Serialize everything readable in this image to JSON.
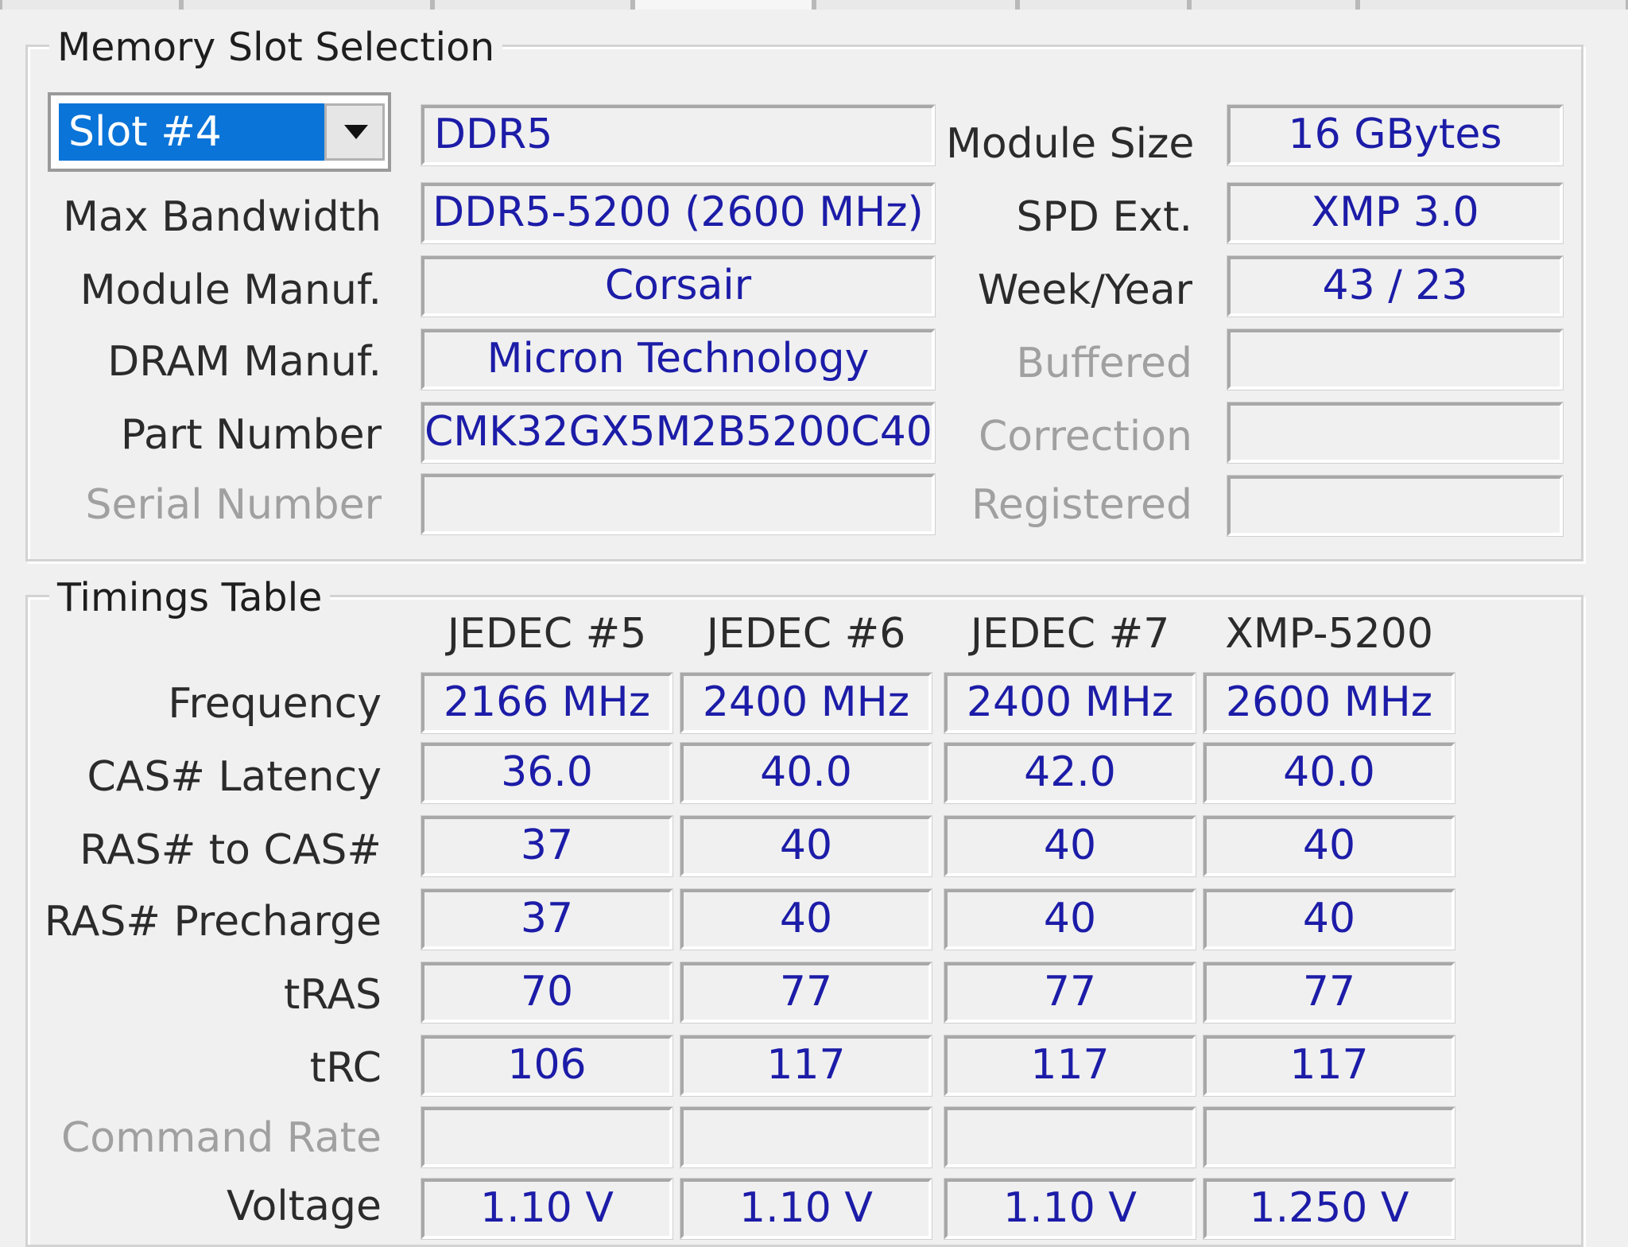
{
  "memory_slot": {
    "group_title": "Memory Slot Selection",
    "slot_selected": "Slot #4",
    "memory_type": "DDR5",
    "rows_left": [
      {
        "label": "Max Bandwidth",
        "value": "DDR5-5200 (2600 MHz)",
        "enabled": true
      },
      {
        "label": "Module Manuf.",
        "value": "Corsair",
        "enabled": true
      },
      {
        "label": "DRAM Manuf.",
        "value": "Micron Technology",
        "enabled": true
      },
      {
        "label": "Part Number",
        "value": "CMK32GX5M2B5200C40",
        "enabled": true
      },
      {
        "label": "Serial Number",
        "value": "",
        "enabled": false
      }
    ],
    "rows_right": [
      {
        "label": "Module Size",
        "value": "16 GBytes",
        "enabled": true
      },
      {
        "label": "SPD Ext.",
        "value": "XMP 3.0",
        "enabled": true
      },
      {
        "label": "Week/Year",
        "value": "43 / 23",
        "enabled": true
      },
      {
        "label": "Buffered",
        "value": "",
        "enabled": false
      },
      {
        "label": "Correction",
        "value": "",
        "enabled": false
      },
      {
        "label": "Registered",
        "value": "",
        "enabled": false
      }
    ]
  },
  "timings": {
    "group_title": "Timings Table",
    "columns": [
      "JEDEC #5",
      "JEDEC #6",
      "JEDEC #7",
      "XMP-5200"
    ],
    "rows": [
      {
        "label": "Frequency",
        "values": [
          "2166 MHz",
          "2400 MHz",
          "2400 MHz",
          "2600 MHz"
        ],
        "enabled": true
      },
      {
        "label": "CAS# Latency",
        "values": [
          "36.0",
          "40.0",
          "42.0",
          "40.0"
        ],
        "enabled": true
      },
      {
        "label": "RAS# to CAS#",
        "values": [
          "37",
          "40",
          "40",
          "40"
        ],
        "enabled": true
      },
      {
        "label": "RAS# Precharge",
        "values": [
          "37",
          "40",
          "40",
          "40"
        ],
        "enabled": true
      },
      {
        "label": "tRAS",
        "values": [
          "70",
          "77",
          "77",
          "77"
        ],
        "enabled": true
      },
      {
        "label": "tRC",
        "values": [
          "106",
          "117",
          "117",
          "117"
        ],
        "enabled": true
      },
      {
        "label": "Command Rate",
        "values": [
          "",
          "",
          "",
          ""
        ],
        "enabled": false
      },
      {
        "label": "Voltage",
        "values": [
          "1.10 V",
          "1.10 V",
          "1.10 V",
          "1.250 V"
        ],
        "enabled": true
      }
    ]
  },
  "colors": {
    "value_text": "#1c1ca8",
    "selection": "#0a74d8",
    "disabled_text": "#a0a0a0"
  }
}
